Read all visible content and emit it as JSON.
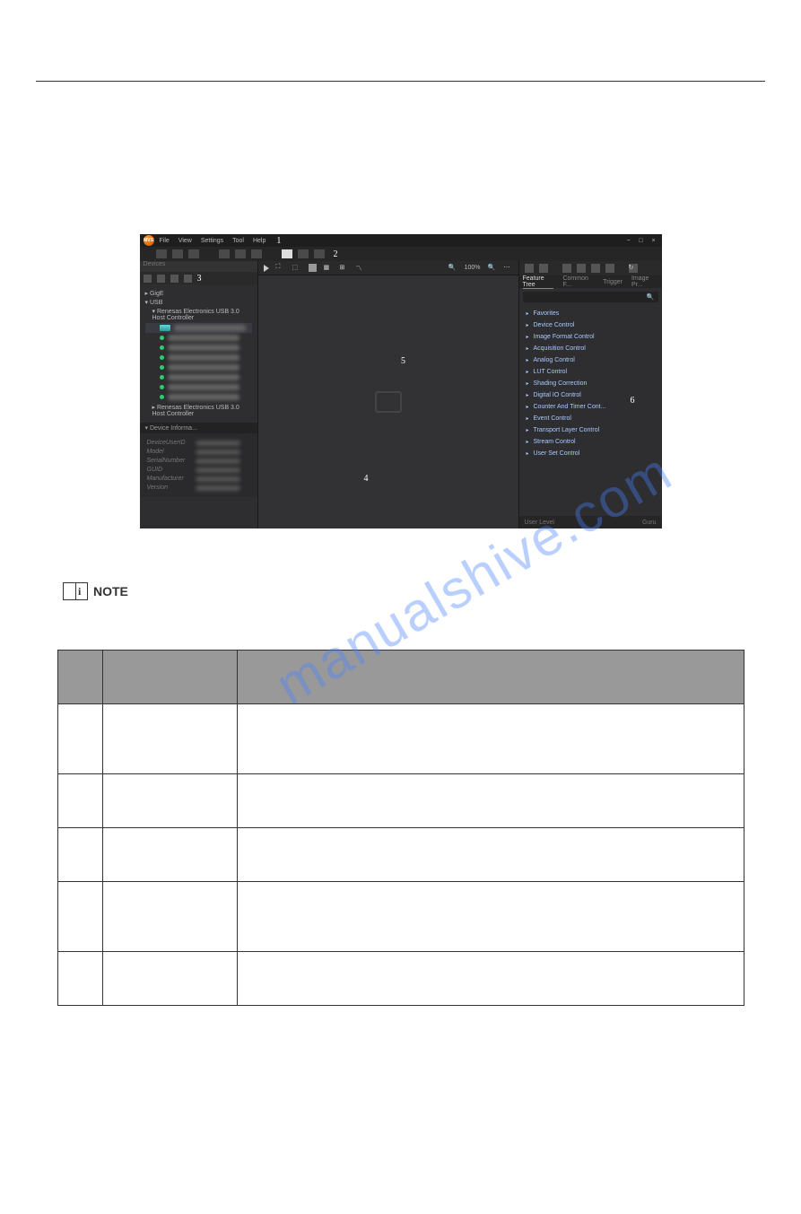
{
  "titlebar": {
    "logo_text": "MVS",
    "menu": {
      "file": "File",
      "view": "View",
      "settings": "Settings",
      "tool": "Tool",
      "help": "Help"
    }
  },
  "window_controls": {
    "min": "−",
    "max": "□",
    "close": "×"
  },
  "annotations": {
    "n1": "1",
    "n2": "2",
    "n3": "3",
    "n4": "4",
    "n5": "5",
    "n6": "6"
  },
  "left": {
    "devices_label": "Devices",
    "gige": "GigE",
    "usb": "USB",
    "host1": "Renesas Electronics USB 3.0 Host Controller",
    "host2": "Renesas Electronics USB 3.0 Host Controller",
    "info_header": "Device Informa...",
    "info": {
      "device_user_id": "DeviceUserID",
      "model": "Model",
      "serial": "SerialNumber",
      "guid": "GUID",
      "manufacturer": "Manufacturer",
      "version": "Version"
    }
  },
  "center": {
    "zoom_pct": "100%",
    "zoom_plus": "+",
    "zoom_minus": "−"
  },
  "right": {
    "tabs": {
      "feature": "Feature Tree",
      "common": "Common F...",
      "trigger": "Trigger",
      "image": "Image Pr..."
    },
    "favorites": "Favorites",
    "device_control": "Device Control",
    "image_format": "Image Format Control",
    "acquisition": "Acquisition Control",
    "analog": "Analog Control",
    "lut": "LUT Control",
    "shading": "Shading Correction",
    "digital_io": "Digital IO Control",
    "counter": "Counter And Timer Cont...",
    "event": "Event Control",
    "transport": "Transport Layer Control",
    "stream": "Stream Control",
    "userset": "User Set Control",
    "user_level": "User Level",
    "guru": "Guru"
  },
  "note_label": "NOTE",
  "watermark": "manualshive.com"
}
